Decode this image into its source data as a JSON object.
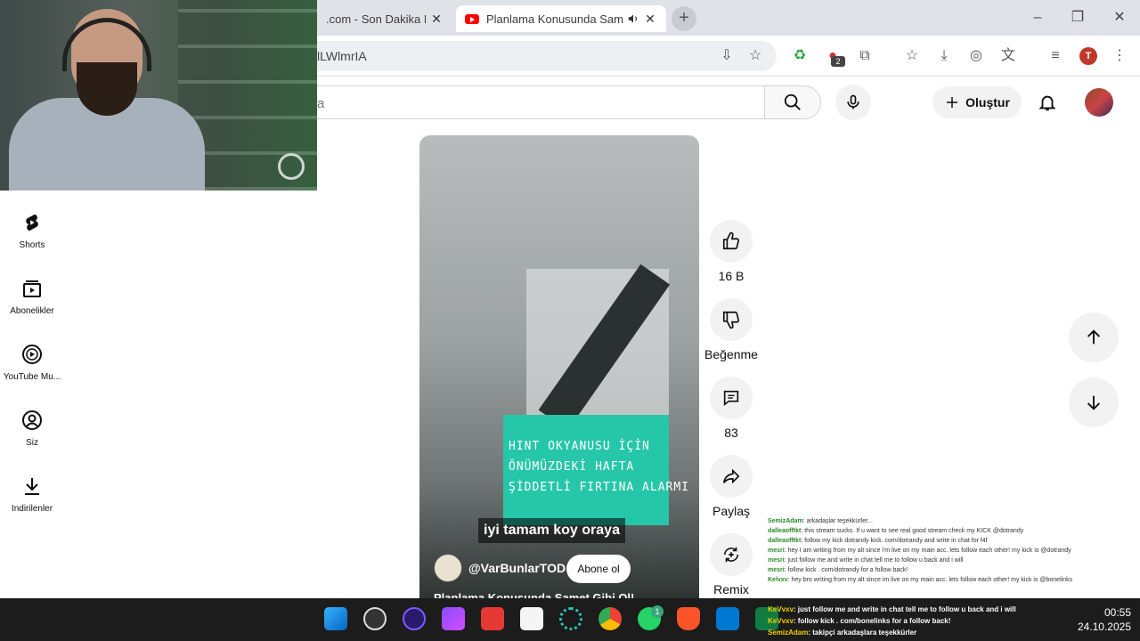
{
  "browser": {
    "tabs": [
      {
        "title": ".com - Son Dakika Hab",
        "close": "✕"
      },
      {
        "title": "Planlama Konusunda Samet",
        "close": "✕"
      }
    ],
    "new_tab": "+",
    "url": "lLWlmrIA",
    "profile_letter": "T",
    "extension_badge": "2"
  },
  "header": {
    "search_placeholder": "a",
    "create_label": "Oluştur"
  },
  "guide": [
    {
      "label": "Shorts",
      "icon": "shorts-icon"
    },
    {
      "label": "Abonelikler",
      "icon": "subscriptions-icon"
    },
    {
      "label": "YouTube Mu...",
      "icon": "youtube-music-icon"
    },
    {
      "label": "Siz",
      "icon": "you-icon"
    },
    {
      "label": "İndirilenler",
      "icon": "downloads-icon"
    }
  ],
  "short": {
    "overlay_lines": [
      "HINT OKYANUSU İÇİN",
      "ÖNÜMÜZDEKİ HAFTA",
      "ŞİDDETLİ FIRTINA ALARMI"
    ],
    "subtitle": "iyi tamam koy oraya",
    "channel": "@VarBunlarTOD",
    "subscribe_label": "Abone ol",
    "title": "Planlama Konusunda Samet Gibi Ol!"
  },
  "actions": {
    "like_count": "16 B",
    "dislike_label": "Beğenme",
    "comment_count": "83",
    "share_label": "Paylaş",
    "remix_label": "Remix"
  },
  "chat": {
    "lines": [
      {
        "user": "SemizAdam",
        "text": ": arkadaşlar teşekkürler..."
      },
      {
        "user": "dalleaofftkt",
        "text": ": this stream sucks. If u want to see real good stream check my KICK @dotrandy"
      },
      {
        "user": "dalleaofftkt",
        "text": ": follow my kick dotrandy kick. com/dotrandy and write in chat for f4f"
      },
      {
        "user": "mesri",
        "text": ": hey I am writing from my alt since i'm live on my main acc. lets follow each other! my kick is @dotrandy"
      },
      {
        "user": "mesri",
        "text": ": just follow me and write in chat tell me to follow u back and i will"
      },
      {
        "user": "mesri",
        "text": ": follow kick . com/dotrandy for a follow back!"
      },
      {
        "user": "Kelvxv",
        "text": ": hey bro writing from my alt since im live on my main acc. lets follow each other! my kick is @bonelinks"
      }
    ],
    "bottom_lines": [
      {
        "user": "KeVvxv",
        "text": ": just follow me and write in chat tell me to follow u back and i will"
      },
      {
        "user": "KeVvxv",
        "text": ": follow kick . com/bonelinks for a follow back!"
      },
      {
        "user": "SemizAdam",
        "text": ": takipçi arkadaşlara teşekkürler"
      }
    ]
  },
  "taskbar": {
    "time": "00:55",
    "date": "24.10.2025",
    "whatsapp_badge": "1"
  },
  "colors": {
    "teal_card": "#26c6a8",
    "youtube_red": "#ff0000",
    "taskbar": "#1c1c1c"
  }
}
